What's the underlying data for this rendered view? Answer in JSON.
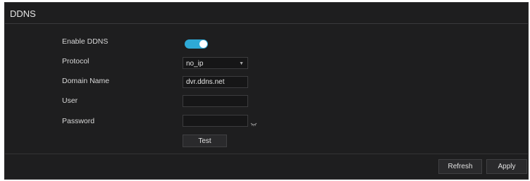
{
  "panel": {
    "title": "DDNS"
  },
  "form": {
    "enable": {
      "label": "Enable DDNS",
      "enabled": true
    },
    "protocol": {
      "label": "Protocol",
      "value": "no_ip"
    },
    "domain": {
      "label": "Domain Name",
      "value": "dvr.ddns.net"
    },
    "user": {
      "label": "User",
      "value": ""
    },
    "password": {
      "label": "Password",
      "value": ""
    },
    "test_label": "Test"
  },
  "footer": {
    "refresh_label": "Refresh",
    "apply_label": "Apply"
  },
  "colors": {
    "accent": "#2ea9d6",
    "panel_bg": "#1e1e1f"
  },
  "icons": {
    "password_toggle": "eye-closed-icon",
    "protocol_dropdown": "caret-down-icon"
  }
}
